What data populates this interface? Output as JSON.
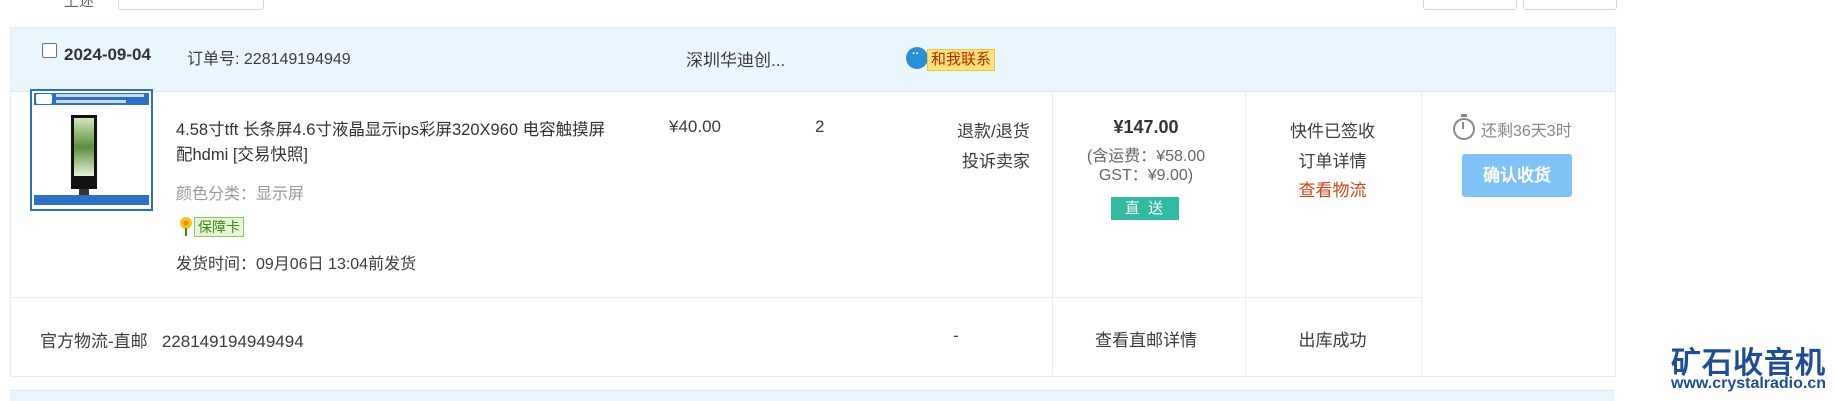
{
  "toolbar": {
    "label": "上述"
  },
  "order": {
    "date": "2024-09-04",
    "order_no": "订单号: 228149194949",
    "shop": "深圳华迪创...",
    "contact": "和我联系",
    "product": {
      "title": "4.58寸tft 长条屏4.6寸液晶显示ips彩屏320X960 电容触摸屏配hdmi [交易快照]",
      "sku": "颜色分类：显示屏",
      "guarantee": "保障卡",
      "ship_time": "发货时间：09月06日 13:04前发货",
      "price": "¥40.00",
      "qty": "2",
      "op_refund": "退款/退货",
      "op_complain": "投诉卖家"
    },
    "total": {
      "amount": "¥147.00",
      "freight": "(含运费：¥58.00",
      "gst": "GST：¥9.00)",
      "badge": "直 送"
    },
    "status": {
      "state": "快件已签收",
      "detail": "订单详情",
      "logistics": "查看物流"
    },
    "action": {
      "remain": "还剩36天3时",
      "confirm": "确认收货"
    },
    "logistics_row": {
      "label": "官方物流-直邮",
      "tracking": "228149194949494",
      "dash": "-",
      "detail": "查看直邮详情",
      "status": "出库成功"
    }
  },
  "watermark": {
    "cn": "矿石收音机",
    "url": "www.crystalradio.cn"
  },
  "colors": {
    "header_bg": "#eaf6fe",
    "accent_link": "#d2451b",
    "direct_badge": "#31b9a1",
    "confirm_button": "#7ec2f6",
    "watermark": "#1e4d96"
  }
}
